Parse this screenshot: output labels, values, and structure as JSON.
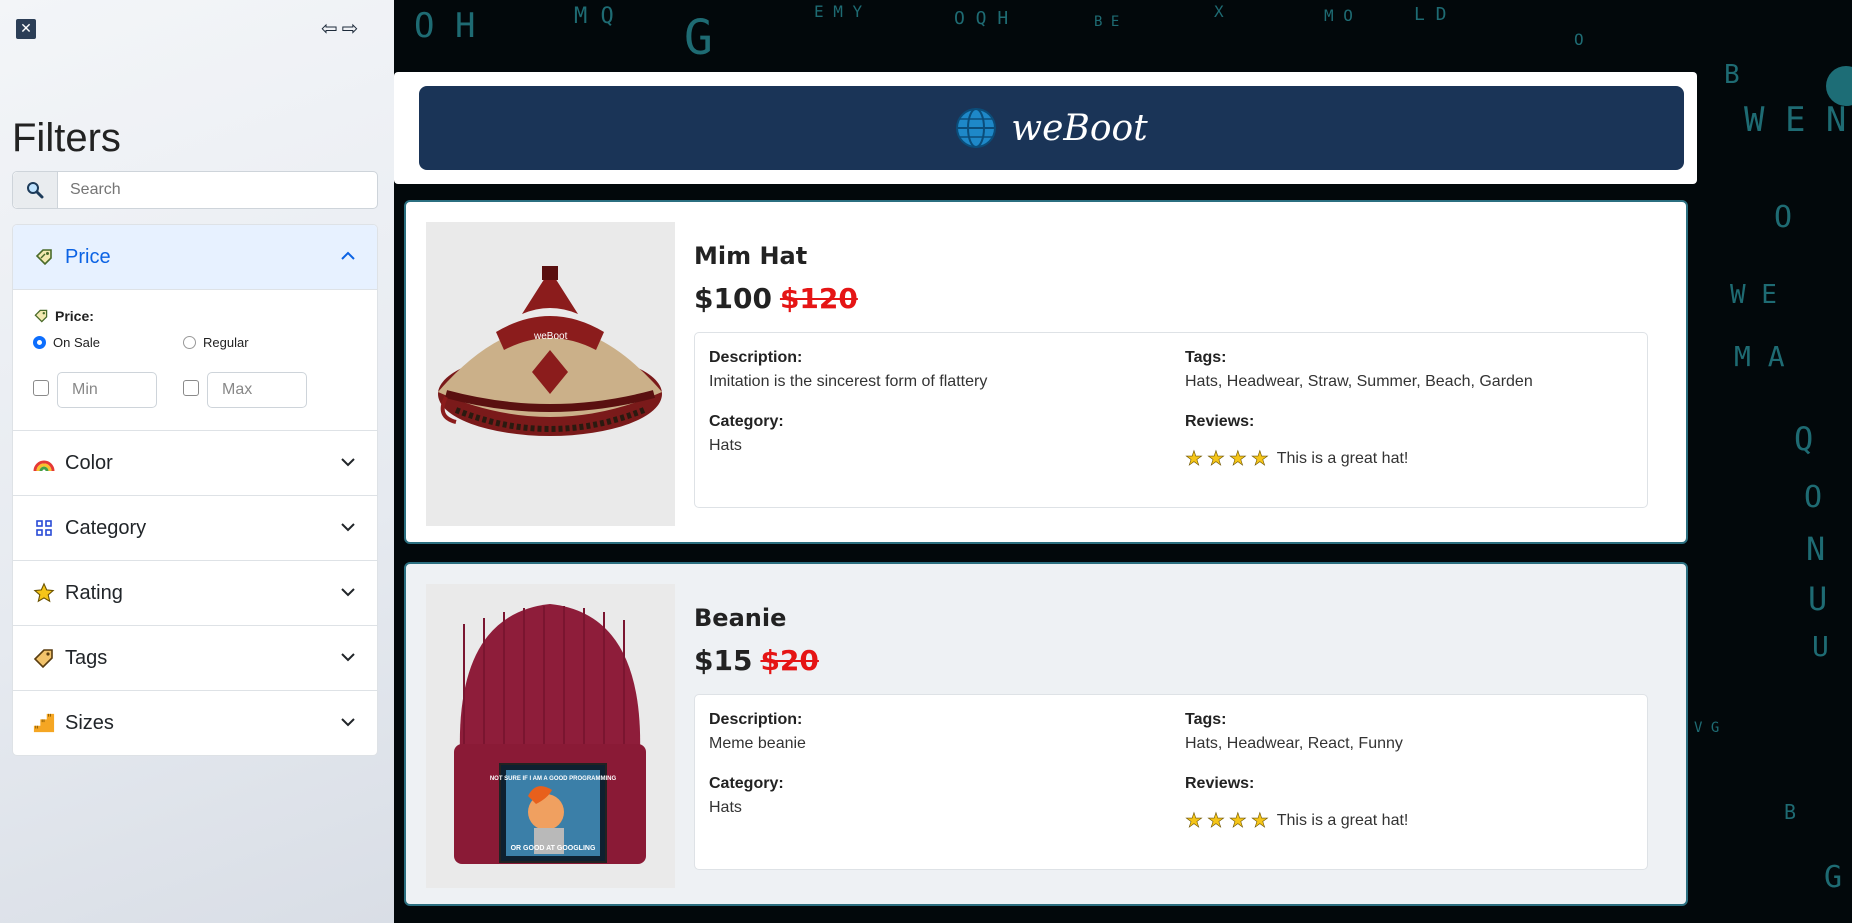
{
  "sidebar": {
    "close_icon": "close-icon",
    "collapse_left_icon": "arrow-left-icon",
    "collapse_right_icon": "arrow-right-icon",
    "title": "Filters",
    "search": {
      "placeholder": "Search"
    },
    "sections": [
      {
        "label": "Price",
        "icon": "price-tag-icon",
        "open": true
      },
      {
        "label": "Color",
        "icon": "rainbow-icon",
        "open": false
      },
      {
        "label": "Category",
        "icon": "grid-icon",
        "open": false
      },
      {
        "label": "Rating",
        "icon": "star-icon",
        "open": false
      },
      {
        "label": "Tags",
        "icon": "tag-icon",
        "open": false
      },
      {
        "label": "Sizes",
        "icon": "ruler-icon",
        "open": false
      }
    ],
    "price_filter": {
      "label": "Price:",
      "options": [
        "On Sale",
        "Regular"
      ],
      "selected": "On Sale",
      "min_placeholder": "Min",
      "max_placeholder": "Max"
    }
  },
  "header": {
    "brand": "weBoot",
    "logo": "globe-icon"
  },
  "products": [
    {
      "name": "Mim Hat",
      "price": "$100",
      "old_price": "$120",
      "description_label": "Description:",
      "description": "Imitation is the sincerest form of flattery",
      "category_label": "Category:",
      "category": "Hats",
      "tags_label": "Tags:",
      "tags": "Hats, Headwear, Straw, Summer, Beach, Garden",
      "reviews_label": "Reviews:",
      "rating": 4,
      "review": "This is a great hat!"
    },
    {
      "name": "Beanie",
      "price": "$15",
      "old_price": "$20",
      "description_label": "Description:",
      "description": "Meme beanie",
      "category_label": "Category:",
      "category": "Hats",
      "tags_label": "Tags:",
      "tags": "Hats, Headwear, React, Funny",
      "reviews_label": "Reviews:",
      "rating": 4,
      "review": "This is a great hat!",
      "image_text_top": "NOT SURE IF I AM A GOOD PROGRAMMING",
      "image_text_bottom": "OR GOOD AT GOOGLING"
    }
  ],
  "colors": {
    "header_bg": "#1a3457",
    "accent": "#0d6efd",
    "old_price": "#e51515",
    "matrix": "#1e6b73"
  }
}
